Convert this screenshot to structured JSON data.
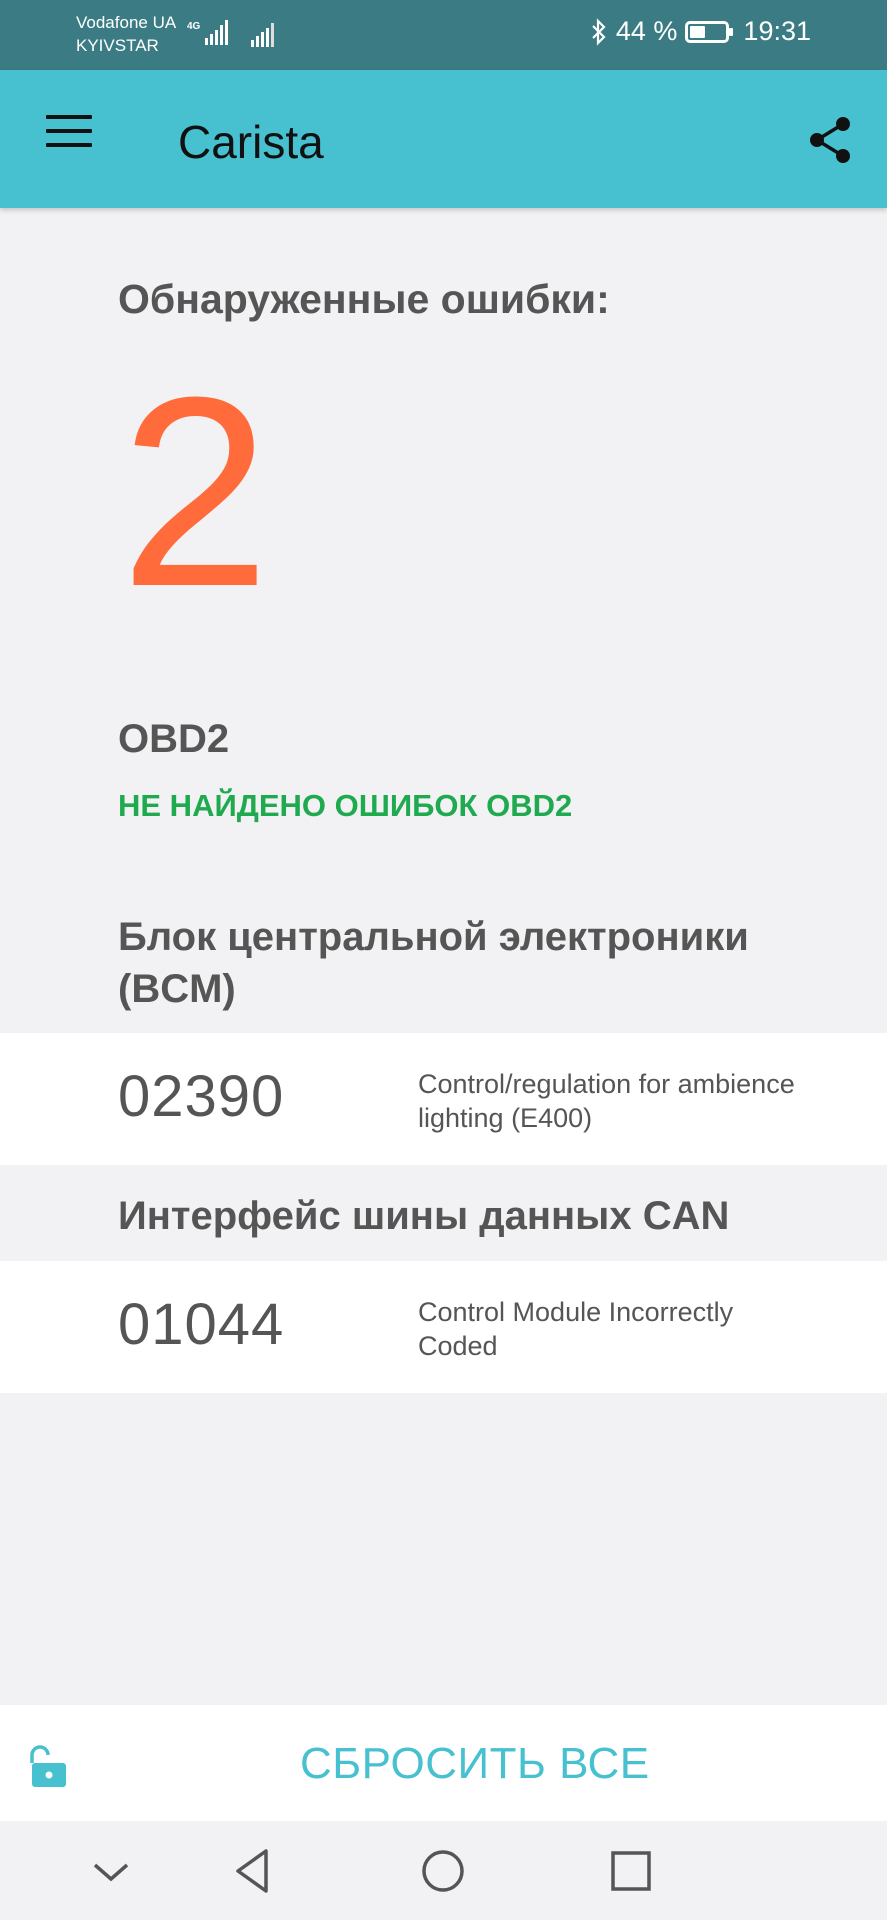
{
  "status_bar": {
    "carrier_1": "Vodafone UA",
    "carrier_2": "KYIVSTAR",
    "network_type": "4G",
    "battery_text": "44 %",
    "battery_level": 0.44,
    "time": "19:31",
    "icons": [
      "signal-icon",
      "bluetooth-icon",
      "battery-icon"
    ]
  },
  "app_bar": {
    "title": "Carista",
    "menu_icon": "menu-icon",
    "share_icon": "share-icon"
  },
  "summary": {
    "label": "Обнаруженные ошибки:",
    "count": "2",
    "count_color": "#ff6b3b"
  },
  "obd2": {
    "title": "OBD2",
    "status": "НЕ НАЙДЕНО ОШИБОК OBD2",
    "status_color": "#1faa50"
  },
  "modules": [
    {
      "title": "Блок центральной электроники (BCM)",
      "errors": [
        {
          "code": "02390",
          "description": "Control/regulation for ambience lighting (E400)"
        }
      ]
    },
    {
      "title": "Интерфейс шины данных CAN",
      "errors": [
        {
          "code": "01044",
          "description": "Control Module Incorrectly Coded"
        }
      ]
    }
  ],
  "actions": {
    "reset_label": "СБРОСИТЬ ВСЕ",
    "lock_icon": "unlock-icon",
    "accent_color": "#47c0d0"
  },
  "nav_bar": {
    "icons": [
      "chevron-down-icon",
      "back-icon",
      "home-icon",
      "recents-icon"
    ]
  }
}
